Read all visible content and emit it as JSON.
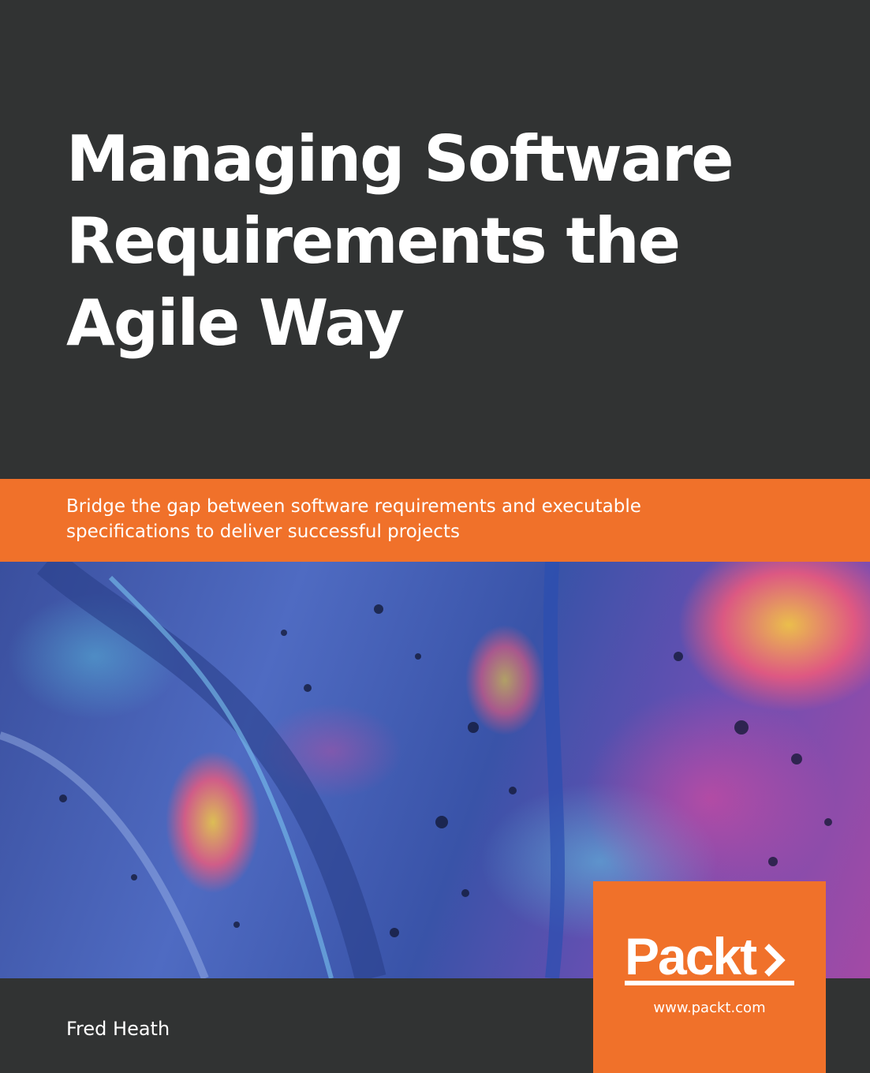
{
  "book": {
    "title_lines": [
      "Managing Software",
      "Requirements the",
      "Agile Way"
    ],
    "subtitle_lines": [
      "Bridge the gap between software requirements and executable",
      "specifications to deliver successful projects"
    ],
    "author": "Fred Heath"
  },
  "publisher": {
    "logo_text": "Packt",
    "url": "www.packt.com"
  },
  "colors": {
    "background": "#313333",
    "accent": "#f0712a",
    "text": "#ffffff"
  }
}
